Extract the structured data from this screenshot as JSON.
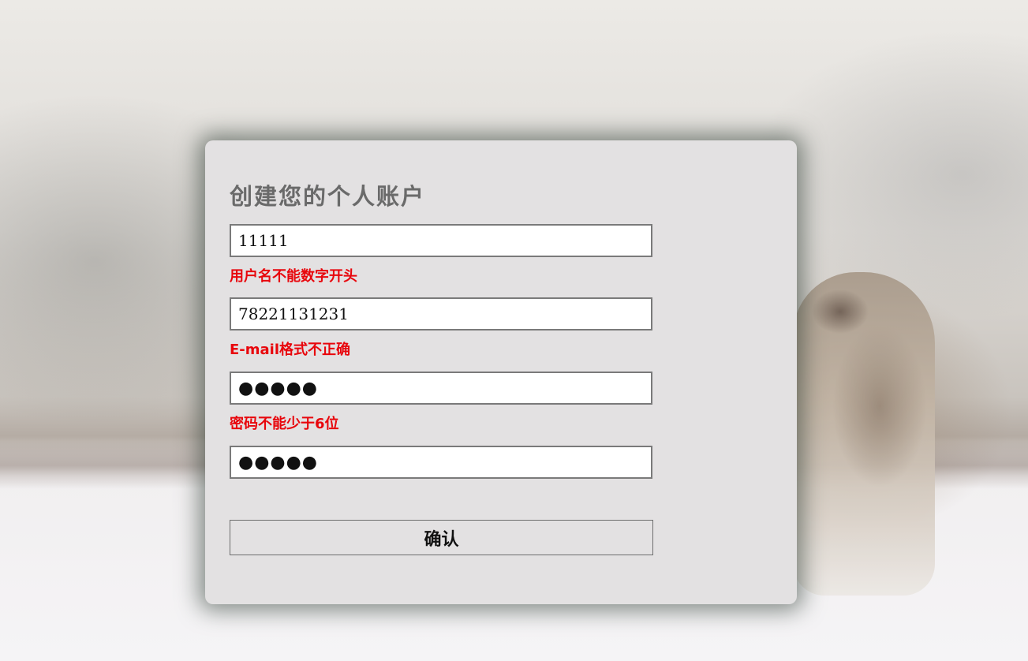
{
  "form": {
    "title": "创建您的个人账户",
    "username": {
      "value": "11111",
      "error": "用户名不能数字开头"
    },
    "email": {
      "value": "78221131231",
      "error": "E-mail格式不正确"
    },
    "password": {
      "value": "●●●●●",
      "error": "密码不能少于6位"
    },
    "confirm_password": {
      "value": "●●●●●"
    },
    "submit_label": "确认"
  },
  "colors": {
    "error": "#e8060c",
    "title": "#6a6a6a",
    "card": "#e3e1e2"
  }
}
